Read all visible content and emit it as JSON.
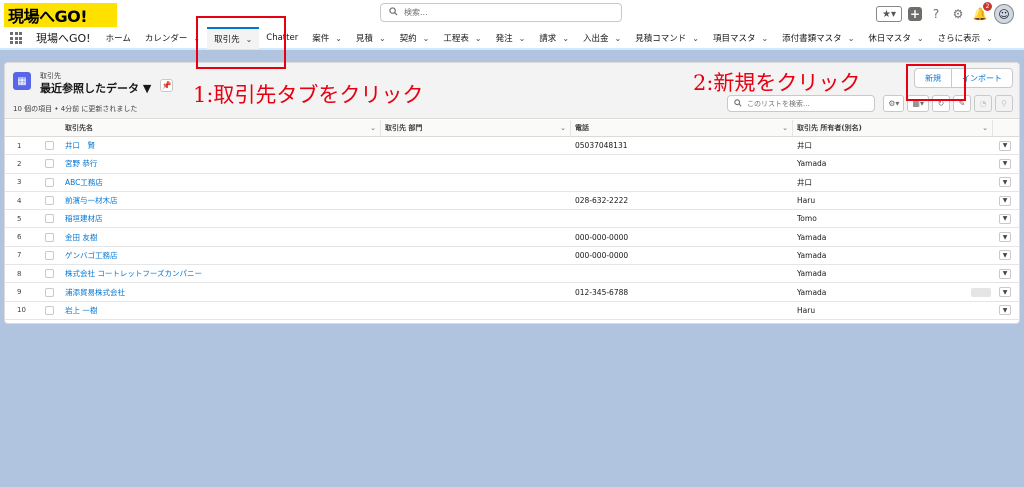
{
  "header": {
    "logo_text": "現場へGO!",
    "search_placeholder": "検索...",
    "notification_count": "2"
  },
  "nav": {
    "app_name": "現場へGO!",
    "items": [
      {
        "label": "ホーム",
        "chevron": false,
        "active": false
      },
      {
        "label": "カレンダー",
        "chevron": true,
        "active": false
      },
      {
        "label": "取引先",
        "chevron": true,
        "active": true
      },
      {
        "label": "Chatter",
        "chevron": false,
        "active": false
      },
      {
        "label": "案件",
        "chevron": true,
        "active": false
      },
      {
        "label": "見積",
        "chevron": true,
        "active": false
      },
      {
        "label": "契約",
        "chevron": true,
        "active": false
      },
      {
        "label": "工程表",
        "chevron": true,
        "active": false
      },
      {
        "label": "発注",
        "chevron": true,
        "active": false
      },
      {
        "label": "請求",
        "chevron": true,
        "active": false
      },
      {
        "label": "入出金",
        "chevron": true,
        "active": false
      },
      {
        "label": "見積コマンド",
        "chevron": true,
        "active": false
      },
      {
        "label": "項目マスタ",
        "chevron": true,
        "active": false
      },
      {
        "label": "添付書類マスタ",
        "chevron": true,
        "active": false
      },
      {
        "label": "休日マスタ",
        "chevron": true,
        "active": false
      },
      {
        "label": "さらに表示",
        "chevron": true,
        "active": false
      }
    ]
  },
  "list_view": {
    "object_label": "取引先",
    "title": "最近参照したデータ ▼",
    "subtitle": "10 個の項目 • 4分前 に更新されました",
    "new_button": "新規",
    "import_button": "インポート",
    "search_placeholder": "このリストを検索..."
  },
  "table": {
    "columns": [
      "取引先名",
      "取引先 部門",
      "電話",
      "取引先 所有者(別名)"
    ],
    "rows": [
      {
        "num": "1",
        "name": "井口　賢",
        "dept": "",
        "phone": "05037048131",
        "owner": "井口"
      },
      {
        "num": "2",
        "name": "宮野 恭行",
        "dept": "",
        "phone": "",
        "owner": "Yamada"
      },
      {
        "num": "3",
        "name": "ABC工務店",
        "dept": "",
        "phone": "",
        "owner": "井口"
      },
      {
        "num": "4",
        "name": "前濱与一材木店",
        "dept": "",
        "phone": "028-632-2222",
        "owner": "Haru"
      },
      {
        "num": "5",
        "name": "稲垣建材店",
        "dept": "",
        "phone": "",
        "owner": "Tomo"
      },
      {
        "num": "6",
        "name": "金田 友樹",
        "dept": "",
        "phone": "000-000-0000",
        "owner": "Yamada"
      },
      {
        "num": "7",
        "name": "ゲンバゴ工務店",
        "dept": "",
        "phone": "000-000-0000",
        "owner": "Yamada"
      },
      {
        "num": "8",
        "name": "株式会社 コートレットフーズカンパニー",
        "dept": "",
        "phone": "",
        "owner": "Yamada"
      },
      {
        "num": "9",
        "name": "浦添貿易株式会社",
        "dept": "",
        "phone": "012-345-6788",
        "owner": "Yamada"
      },
      {
        "num": "10",
        "name": "岩上 一樹",
        "dept": "",
        "phone": "",
        "owner": "Haru"
      }
    ]
  },
  "annotations": {
    "step1": "1:取引先タブをクリック",
    "step2": "2:新規をクリック",
    "color": "#e60012"
  }
}
